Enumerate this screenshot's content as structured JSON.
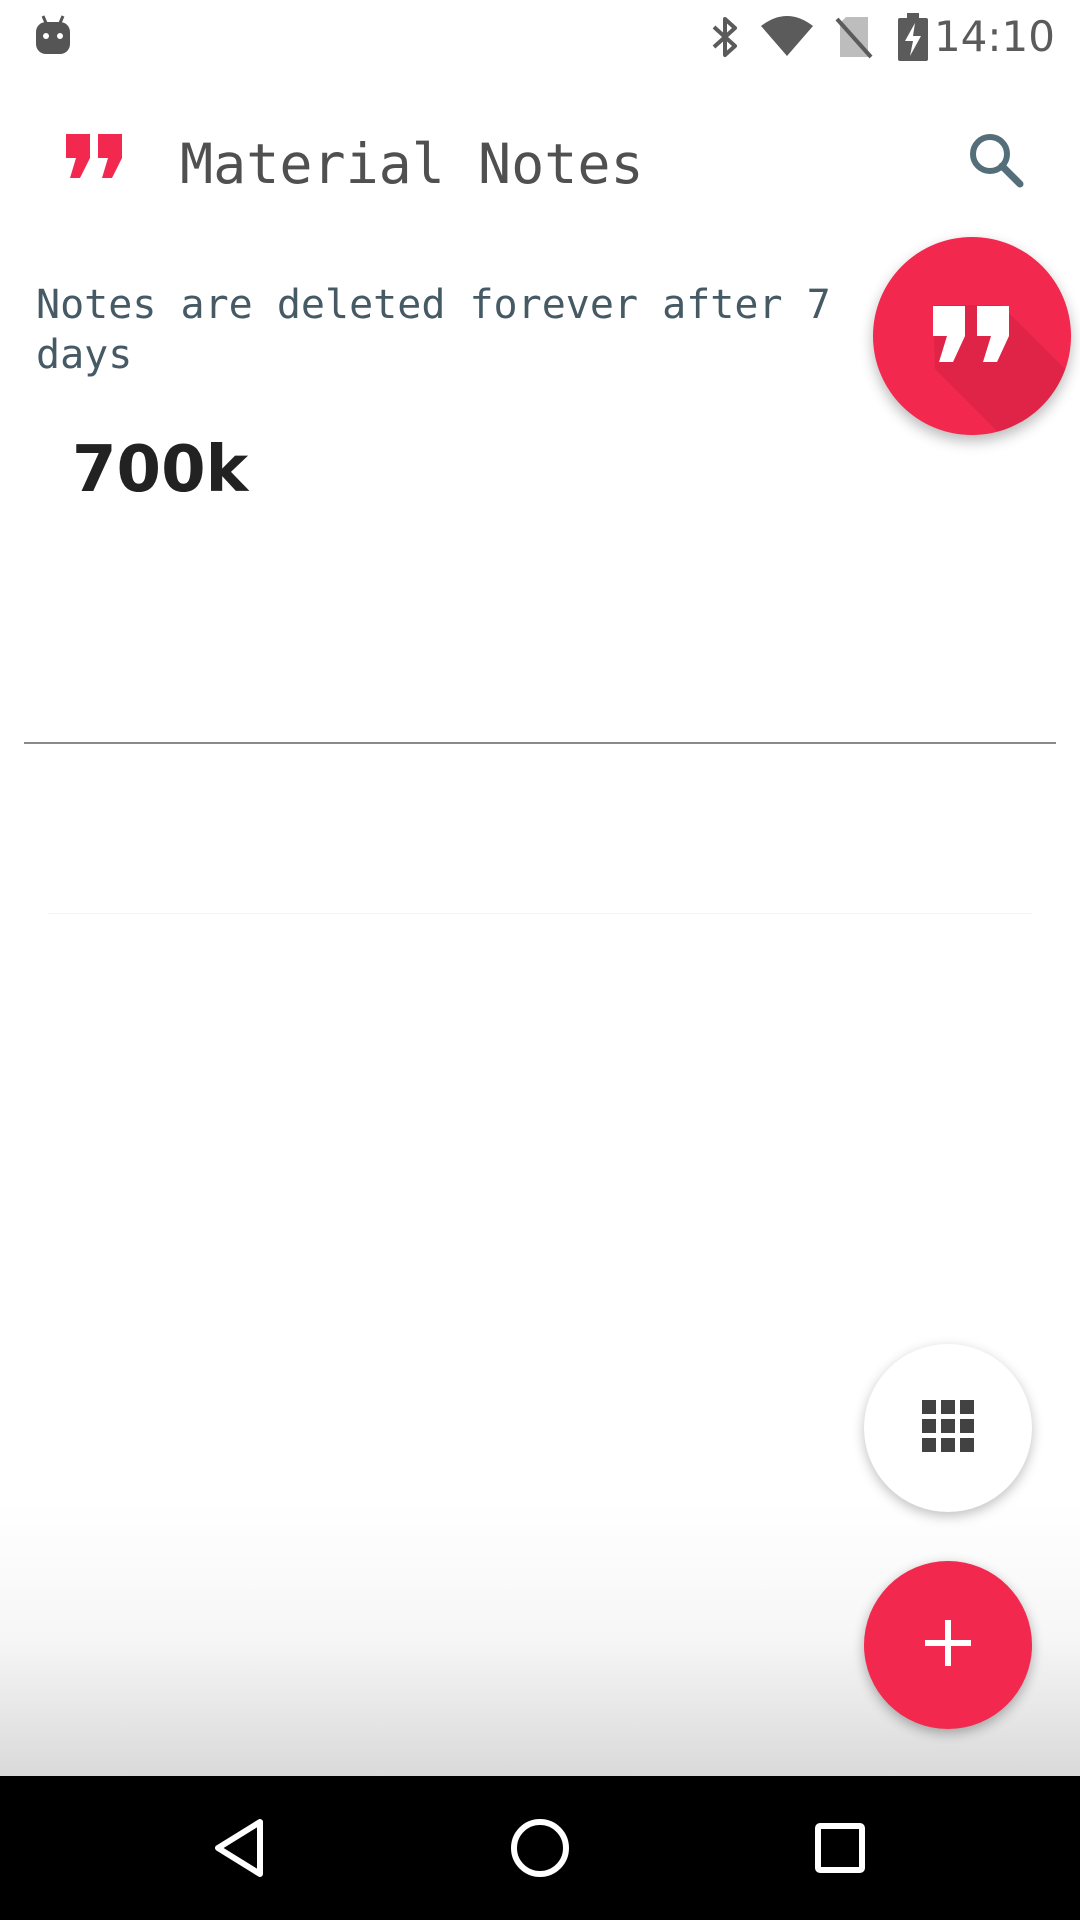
{
  "status_bar": {
    "time": "14:10",
    "icons": [
      "android-debug-icon",
      "bluetooth-icon",
      "wifi-icon",
      "no-sim-icon",
      "battery-charging-icon"
    ]
  },
  "toolbar": {
    "title": "Material Notes",
    "logo_icon": "quote-icon",
    "search_icon": "search-icon"
  },
  "notice": {
    "text": "Notes are deleted forever after 7 days"
  },
  "notes": [
    {
      "title": "700k"
    }
  ],
  "fabs": {
    "quote_icon": "quote-icon",
    "grid_icon": "grid-icon",
    "add_icon": "plus-icon"
  },
  "nav_bar": {
    "icons": [
      "back-icon",
      "home-icon",
      "recents-icon"
    ]
  },
  "colors": {
    "accent": "#f2284e",
    "notice_text": "#455a64",
    "title_text": "#505050"
  }
}
